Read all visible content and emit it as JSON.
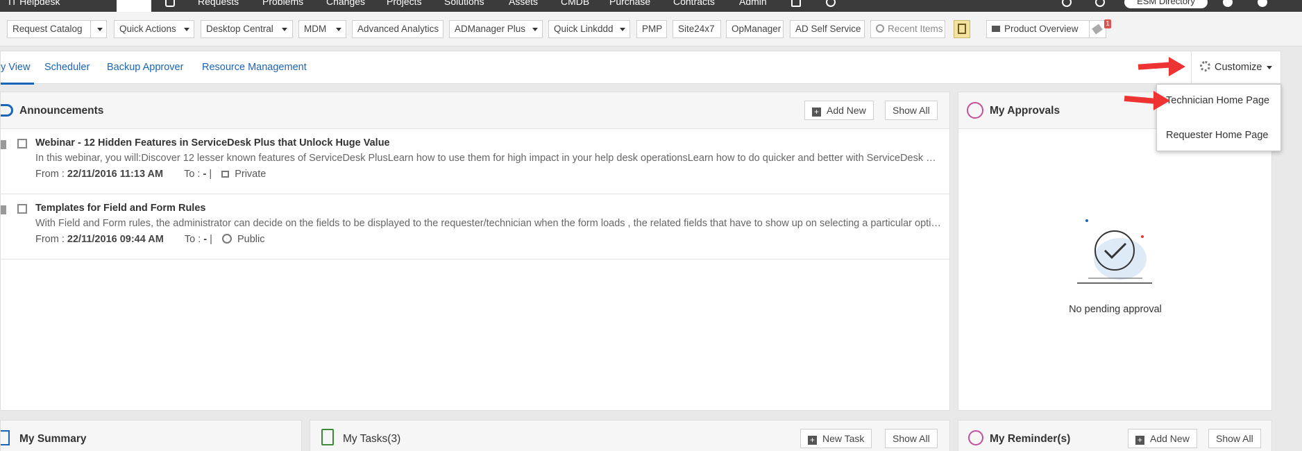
{
  "topnav": {
    "app_label": "IT Helpdesk",
    "items": [
      "Requests",
      "Problems",
      "Changes",
      "Projects",
      "Solutions",
      "Assets",
      "CMDB",
      "Purchase",
      "Contracts",
      "Admin"
    ],
    "directory_label": "ESM Directory"
  },
  "quicklinks": [
    {
      "label": "Request Catalog",
      "caret": true
    },
    {
      "label": "Quick Actions",
      "caret": true
    },
    {
      "label": "Desktop Central",
      "caret": true
    },
    {
      "label": "MDM",
      "caret": true
    },
    {
      "label": "Advanced Analytics",
      "caret": false
    },
    {
      "label": "ADManager Plus",
      "caret": true
    },
    {
      "label": "Quick Linkddd",
      "caret": true
    },
    {
      "label": "PMP",
      "caret": false
    },
    {
      "label": "Site24x7",
      "caret": false
    },
    {
      "label": "OpManager",
      "caret": false
    },
    {
      "label": "AD Self Service",
      "caret": false
    }
  ],
  "recent_items_label": "Recent Items",
  "product_overview_label": "Product Overview",
  "notification_count": "1",
  "tabs": {
    "my_view": "y View",
    "scheduler": "Scheduler",
    "backup_approver": "Backup Approver",
    "resource_management": "Resource Management"
  },
  "customize": {
    "label": "Customize",
    "menu": [
      "Technician Home Page",
      "Requester Home Page"
    ]
  },
  "announcements": {
    "title": "Announcements",
    "add_new": "Add New",
    "show_all": "Show All",
    "items": [
      {
        "title": "Webinar - 12 Hidden Features in ServiceDesk Plus that Unlock Huge Value",
        "desc": "In this webinar, you will:Discover 12 lesser known features of ServiceDesk PlusLearn how to use them for high impact in your help desk operationsLearn how to do quicker and better with ServiceDesk Plus",
        "from_label": "From :",
        "from": "22/11/2016 11:13 AM",
        "to_label": "To :",
        "to": "-",
        "sep": "|",
        "visibility": "Private"
      },
      {
        "title": "Templates for Field and Form Rules",
        "desc": "With Field and Form rules, the administrator can decide on the fields to be displayed to the requester/technician when the form loads , the related fields that have to show up on selecting a particular option",
        "from_label": "From :",
        "from": "22/11/2016 09:44 AM",
        "to_label": "To :",
        "to": "-",
        "sep": "|",
        "visibility": "Public"
      }
    ]
  },
  "approvals": {
    "title": "My Approvals",
    "empty_text": "No pending approval"
  },
  "summary": {
    "title": "My Summary"
  },
  "tasks": {
    "title": "My Tasks(3)",
    "new_task": "New Task",
    "show_all": "Show All"
  },
  "reminders": {
    "title": "My Reminder(s)",
    "add_new": "Add New",
    "show_all": "Show All"
  },
  "colors": {
    "link": "#1a65b8",
    "arrow": "#e33333",
    "topnav": "#3b3b3b"
  }
}
